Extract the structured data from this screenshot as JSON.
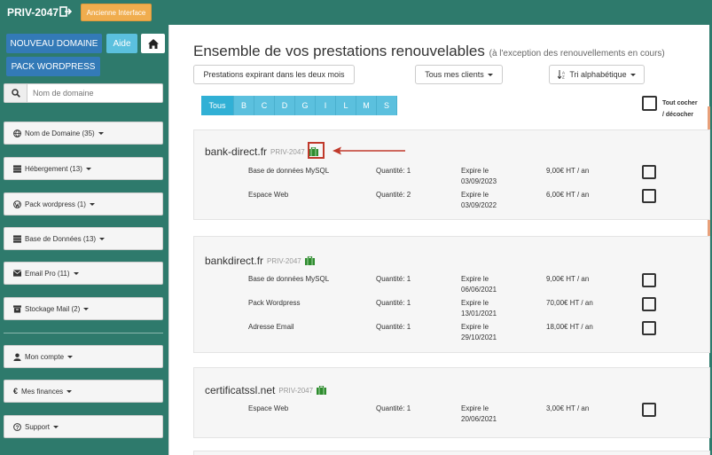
{
  "topbar": {
    "brand": "PRIV-2047",
    "old_interface_label": "Ancienne Interface"
  },
  "sidebar": {
    "new_domain_label": "NOUVEAU DOMAINE",
    "aide_label": "Aide",
    "pack_wordpress_label": "PACK WORDPRESS",
    "search_placeholder": "Nom de domaine",
    "nav": [
      {
        "label": "Nom de Domaine (35)",
        "icon": "globe-icon"
      },
      {
        "label": "Hébergement (13)",
        "icon": "server-icon"
      },
      {
        "label": "Pack wordpress (1)",
        "icon": "wordpress-icon"
      },
      {
        "label": "Base de Données (13)",
        "icon": "database-icon"
      },
      {
        "label": "Email Pro (11)",
        "icon": "envelope-icon"
      },
      {
        "label": "Stockage Mail (2)",
        "icon": "archive-icon"
      }
    ],
    "account": [
      {
        "label": "Mon compte",
        "icon": "user-icon"
      },
      {
        "label": "Mes finances",
        "icon": "euro-icon"
      },
      {
        "label": "Support",
        "icon": "question-icon"
      }
    ]
  },
  "main": {
    "title": "Ensemble de vos prestations renouvelables",
    "subtitle": "(à l'exception des renouvellements en cours)",
    "filters": {
      "expiring": "Prestations expirant dans les deux mois",
      "clients": "Tous mes clients",
      "sort": "Tri alphabétique"
    },
    "letters": [
      "Tous",
      "B",
      "C",
      "D",
      "G",
      "I",
      "L",
      "M",
      "S"
    ],
    "check_all": {
      "line1": "Tout cocher",
      "line2": "/ décocher"
    },
    "cards": [
      {
        "domain": "bank-direct.fr",
        "tag": "PRIV-2047",
        "items": [
          {
            "name": "Base de données MySQL",
            "qty": "Quantité: 1",
            "exp1": "Expire le",
            "exp2": "03/09/2023",
            "price": "9,00€ HT / an"
          },
          {
            "name": "Espace Web",
            "qty": "Quantité: 2",
            "exp1": "Expire le",
            "exp2": "03/09/2022",
            "price": "6,00€ HT / an"
          }
        ]
      },
      {
        "domain": "bankdirect.fr",
        "tag": "PRIV-2047",
        "items": [
          {
            "name": "Base de données MySQL",
            "qty": "Quantité: 1",
            "exp1": "Expire le",
            "exp2": "06/06/2021",
            "price": "9,00€ HT / an"
          },
          {
            "name": "Pack Wordpress",
            "qty": "Quantité: 1",
            "exp1": "Expire le",
            "exp2": "13/01/2021",
            "price": "70,00€ HT / an"
          },
          {
            "name": "Adresse Email",
            "qty": "Quantité: 1",
            "exp1": "Expire le",
            "exp2": "29/10/2021",
            "price": "18,00€ HT / an"
          }
        ]
      },
      {
        "domain": "certificatssl.net",
        "tag": "PRIV-2047",
        "items": [
          {
            "name": "Espace Web",
            "qty": "Quantité: 1",
            "exp1": "Expire le",
            "exp2": "20/06/2021",
            "price": "3,00€ HT / an"
          }
        ]
      }
    ]
  },
  "colors": {
    "sidebar_bg": "#2e7a6c",
    "primary": "#337ab7",
    "info": "#5bc0de",
    "warning": "#f0ad4e",
    "bag_green": "#2e8b2e",
    "annotation_red": "#c0392b"
  }
}
